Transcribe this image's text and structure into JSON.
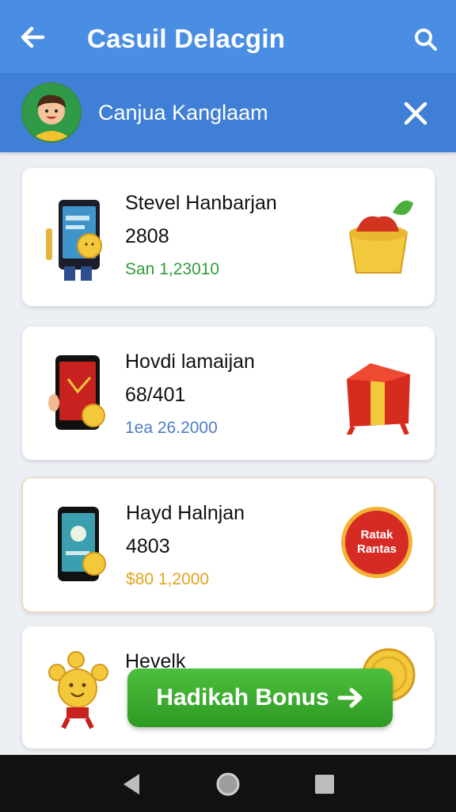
{
  "header": {
    "title": "Casuil Delacgin",
    "back_icon": "arrow-left-icon",
    "search_icon": "search-icon",
    "bg_color": "#4a8ee4"
  },
  "profile": {
    "name": "Canjua Kanglaam",
    "close_icon": "close-icon"
  },
  "items": [
    {
      "name": "Stevel Hanbarjan",
      "value": "2808",
      "sub": "San 1,23010",
      "sub_color": "#2f9e3a",
      "left_icon": "phone-coin-character-icon",
      "right_icon": "jam-pot-icon"
    },
    {
      "name": "Hovdi lamaijan",
      "value": "68/401",
      "sub": "1ea 26.2000",
      "sub_color": "#4f7cc4",
      "left_icon": "phone-coin-icon",
      "right_icon": "gift-box-icon"
    },
    {
      "name": "Hayd Halnjan",
      "value": "4803",
      "sub": "$80 1,2000",
      "sub_color": "#e2a21e",
      "left_icon": "phone-coin-icon",
      "right_icon": "reward-badge-icon",
      "badge_text": "Ratak Rantas"
    },
    {
      "name": "Hevelk",
      "left_icon": "coin-mascot-icon",
      "right_icon": "coin-icon"
    }
  ],
  "bonus_button": {
    "label": "Hadikah Bonus",
    "icon": "arrow-right-icon"
  },
  "nav": {
    "back_icon": "nav-back-icon",
    "home_icon": "nav-home-icon",
    "recents_icon": "nav-recents-icon"
  }
}
